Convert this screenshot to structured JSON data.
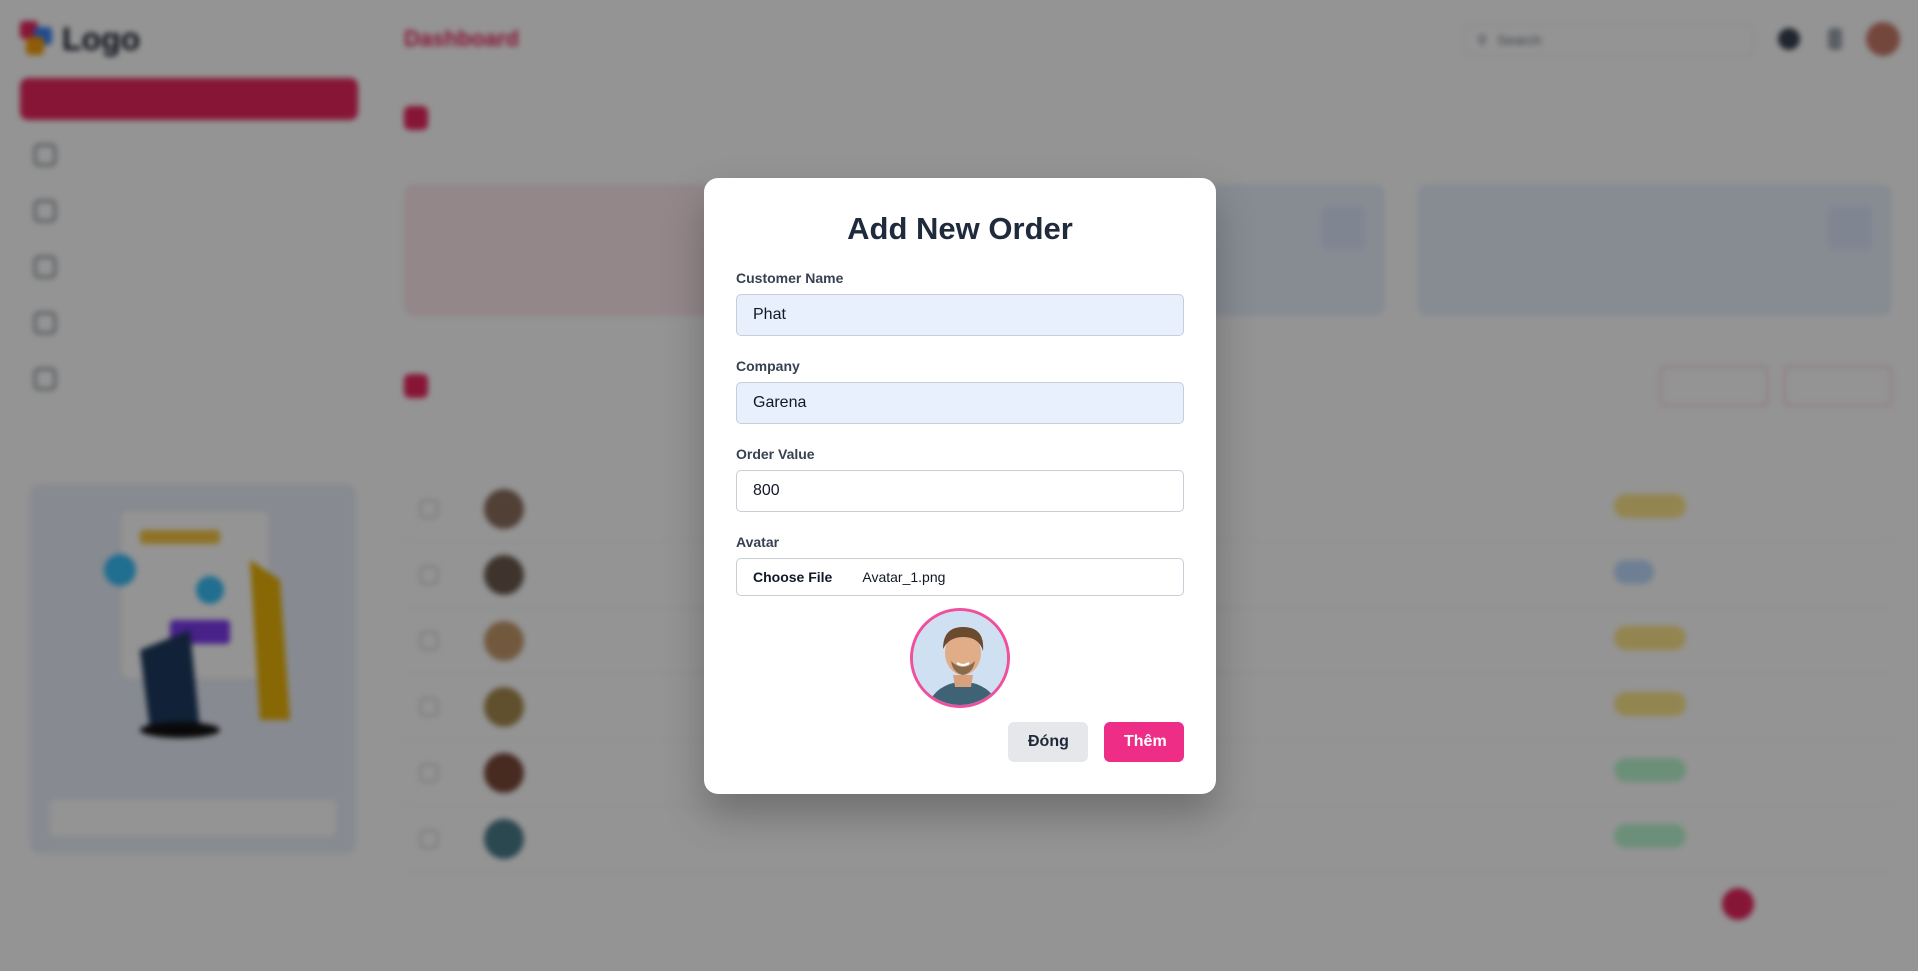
{
  "app": {
    "logo_text": "Logo",
    "header_title": "Dashboard",
    "search_placeholder": "Search"
  },
  "modal": {
    "title": "Add New Order",
    "customer_label": "Customer Name",
    "customer_value": "Phat",
    "company_label": "Company",
    "company_value": "Garena",
    "order_value_label": "Order Value",
    "order_value_value": "800",
    "avatar_label": "Avatar",
    "choose_file_label": "Choose File",
    "file_name": "Avatar_1.png",
    "close_label": "Đóng",
    "add_label": "Thêm"
  }
}
